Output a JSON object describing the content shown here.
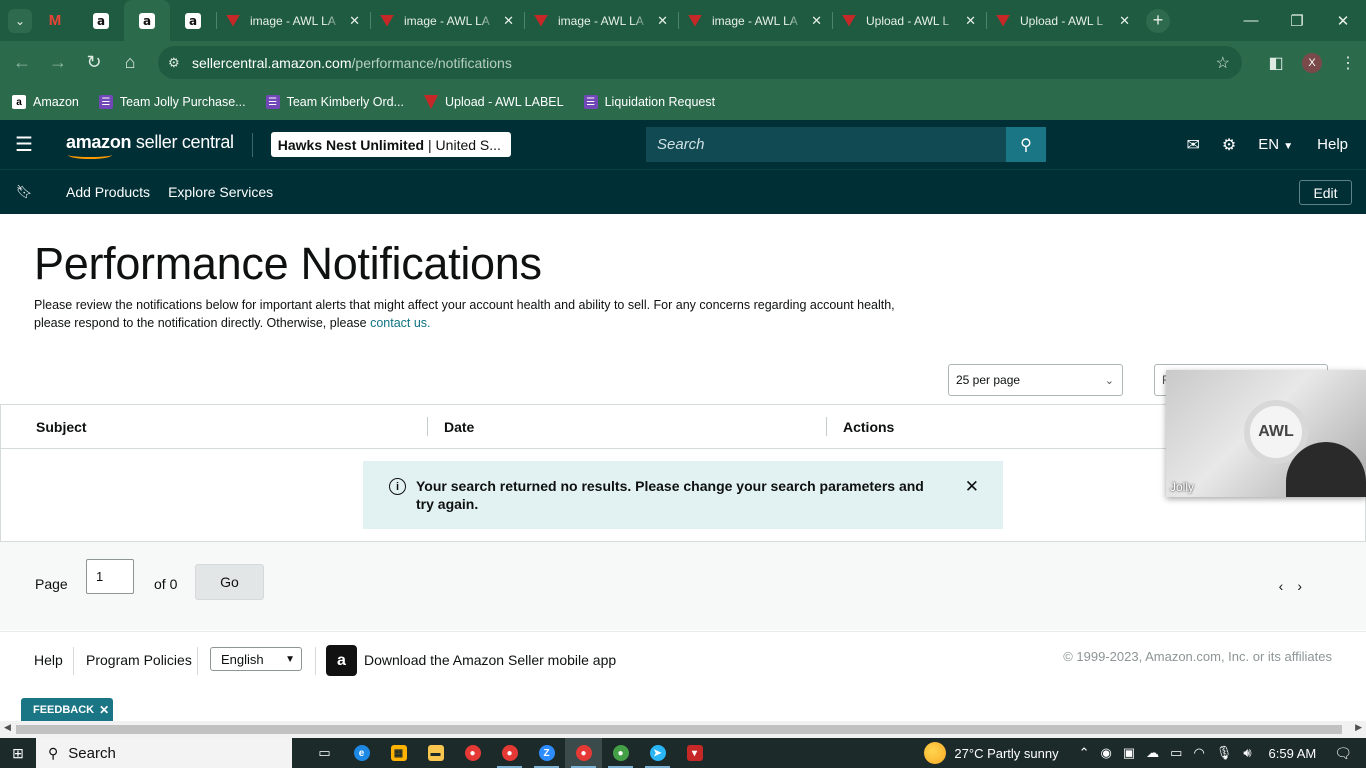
{
  "browser": {
    "tabs": [
      {
        "title": "image - AWL LA"
      },
      {
        "title": "image - AWL LA"
      },
      {
        "title": "image - AWL LA"
      },
      {
        "title": "image - AWL LA"
      },
      {
        "title": "Upload - AWL L"
      },
      {
        "title": "Upload - AWL L"
      }
    ],
    "url_host": "sellercentral.amazon.com",
    "url_path": "/performance/notifications",
    "profile_initial": "X",
    "bookmarks": [
      {
        "label": "Amazon",
        "icon": "amazon-icon"
      },
      {
        "label": "Team Jolly Purchase...",
        "icon": "form-icon"
      },
      {
        "label": "Team Kimberly Ord...",
        "icon": "form-icon"
      },
      {
        "label": "Upload - AWL LABEL",
        "icon": "awl-icon"
      },
      {
        "label": "Liquidation Request",
        "icon": "form-icon"
      }
    ]
  },
  "header": {
    "logo_bold": "amazon",
    "logo_rest": " seller central",
    "store_name": "Hawks Nest Unlimited",
    "store_region": "| United S...",
    "search_placeholder": "Search",
    "language": "EN",
    "help": "Help"
  },
  "nav": {
    "links": [
      "Add Products",
      "Explore Services"
    ],
    "edit": "Edit"
  },
  "main": {
    "title": "Performance Notifications",
    "intro": "Please review the notifications below for important alerts that might affect your account health and ability to sell. For any concerns regarding account health, please respond to the notification directly. Otherwise, please ",
    "contact_link": "contact us.",
    "per_page": "25 per page",
    "filter_partial": "F",
    "columns": [
      "Subject",
      "Date",
      "Actions"
    ],
    "alert": "Your search returned no results. Please change your search parameters and try again.",
    "pager": {
      "page_label": "Page",
      "page_value": "1",
      "of_label": "of 0",
      "go": "Go"
    }
  },
  "footer": {
    "help": "Help",
    "policies": "Program Policies",
    "language": "English",
    "app_text": "Download the Amazon Seller mobile app",
    "copyright": "© 1999-2023, Amazon.com, Inc. or its affiliates",
    "feedback": "FEEDBACK"
  },
  "video": {
    "name": "Jolly"
  },
  "taskbar": {
    "search": "Search",
    "weather": "27°C  Partly sunny",
    "time": "6:59 AM"
  },
  "colors": {
    "chrome_tabstrip": "#1f5b40",
    "chrome_toolbar": "#2b6b4c",
    "sc_header": "#002f36",
    "accent_teal": "#1a7684",
    "alert_bg": "#e2f1f2",
    "link": "#0e7381"
  }
}
